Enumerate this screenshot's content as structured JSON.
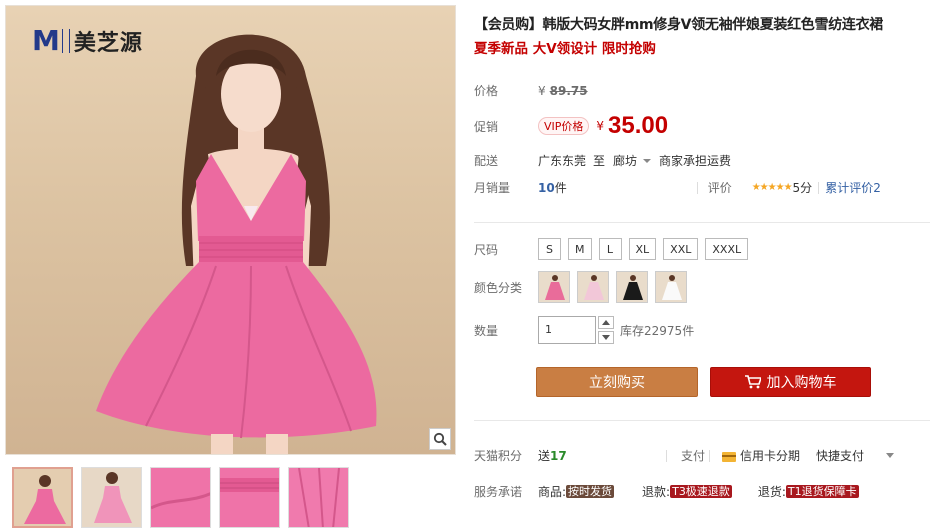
{
  "brand": {
    "mark": "M",
    "name": "美芝源"
  },
  "product": {
    "title": "【会员购】韩版大码女胖mm修身V领无袖伴娘夏装红色雪纺连衣裙",
    "subtitle": "夏季新品 大V领设计 限时抢购"
  },
  "price": {
    "label": "价格",
    "currency": "¥",
    "original": "89.75",
    "promo_label": "促销",
    "vip_tag": "VIP价格",
    "promo": "35.00"
  },
  "shipping": {
    "label": "配送",
    "from": "广东东莞",
    "to_word": "至",
    "destination": "廊坊",
    "fee": "商家承担运费"
  },
  "stats": {
    "monthly_label": "月销量",
    "monthly_value": "10",
    "monthly_unit": "件",
    "rating_label": "评价",
    "stars": "★★★★★",
    "score": "5分",
    "reviews_label": "累计评价",
    "reviews_count": "2"
  },
  "size": {
    "label": "尺码",
    "options": [
      "S",
      "M",
      "L",
      "XL",
      "XXL",
      "XXXL"
    ]
  },
  "color": {
    "label": "颜色分类",
    "swatches": [
      "#e96c9a",
      "#f2c7d8",
      "#1a1a1a",
      "#fafafa"
    ]
  },
  "quantity": {
    "label": "数量",
    "value": "1",
    "stock_prefix": "库存",
    "stock": "22975",
    "stock_unit": "件"
  },
  "actions": {
    "buy_now": "立刻购买",
    "add_cart": "加入购物车"
  },
  "points": {
    "label": "天猫积分",
    "prefix": "送",
    "value": "17"
  },
  "payment": {
    "label": "支付",
    "card": "信用卡分期",
    "quick": "快捷支付"
  },
  "service": {
    "label": "服务承诺",
    "goods_label": "商品:",
    "goods_tag": "按时发货",
    "refund_label": "退款:",
    "refund_tag": "T3极速退款",
    "return_label": "退货:",
    "return_tag": "T1退货保障卡"
  },
  "colors": {
    "price_red": "#c40000",
    "buy_btn": "#c97e43",
    "cart_btn": "#c4160f",
    "dress_pink": "#ec6aa0"
  }
}
